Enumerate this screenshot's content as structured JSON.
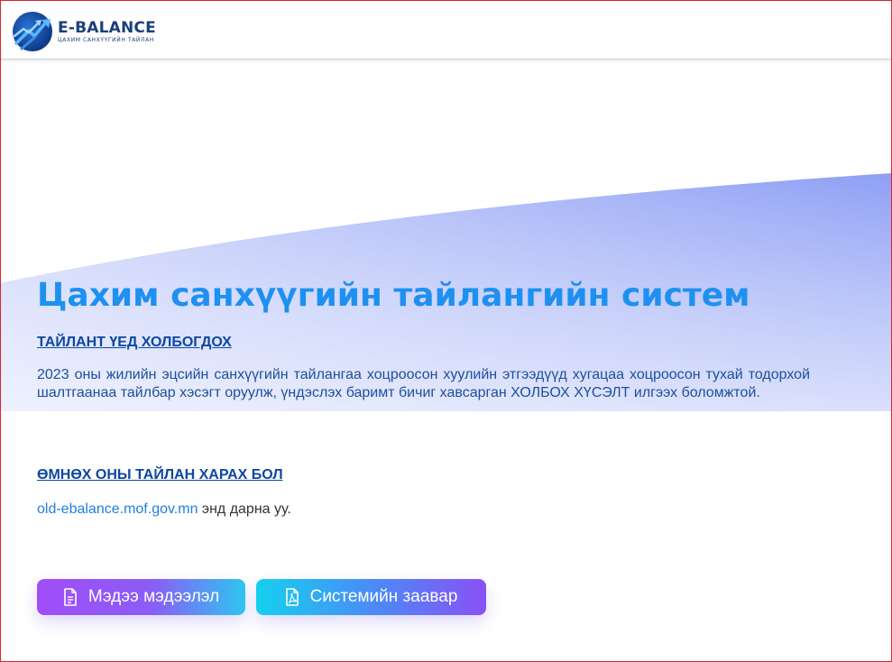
{
  "header": {
    "logo": {
      "title": "E-BALANCE",
      "subtitle": "ЦАХИМ САНХҮҮГИЙН ТАЙЛАН",
      "icon": "rising-arrows-logo-icon"
    }
  },
  "hero": {
    "title": "Цахим санхүүгийн тайлангийн систем"
  },
  "section1": {
    "heading": "ТАЙЛАНТ ҮЕД ХОЛБОГДОХ",
    "text": "2023 оны жилийн эцсийн санхүүгийн тайлангаа хоцроосон хуулийн этгээдүүд хугацаа хоцроосон тухай тодорхой шалтгаанаа тайлбар хэсэгт оруулж, үндэслэх баримт бичиг хавсарган ХОЛБОХ ХҮСЭЛТ илгээх боломжтой."
  },
  "section2": {
    "heading": "ӨМНӨХ ОНЫ ТАЙЛАН ХАРАХ БОЛ",
    "link_text": "old-ebalance.mof.gov.mn",
    "suffix": " энд дарна уу."
  },
  "buttons": {
    "news": {
      "label": "Мэдээ мэдээлэл",
      "icon": "document-icon"
    },
    "guide": {
      "label": "Системийн заавар",
      "icon": "pdf-file-icon"
    }
  },
  "colors": {
    "title": "#1e90f0",
    "heading": "#0d47a1",
    "body_text": "#1c4f9e",
    "link": "#1e7fe0",
    "wave": "#8fa0f4",
    "frame_border": "#d8262e"
  }
}
